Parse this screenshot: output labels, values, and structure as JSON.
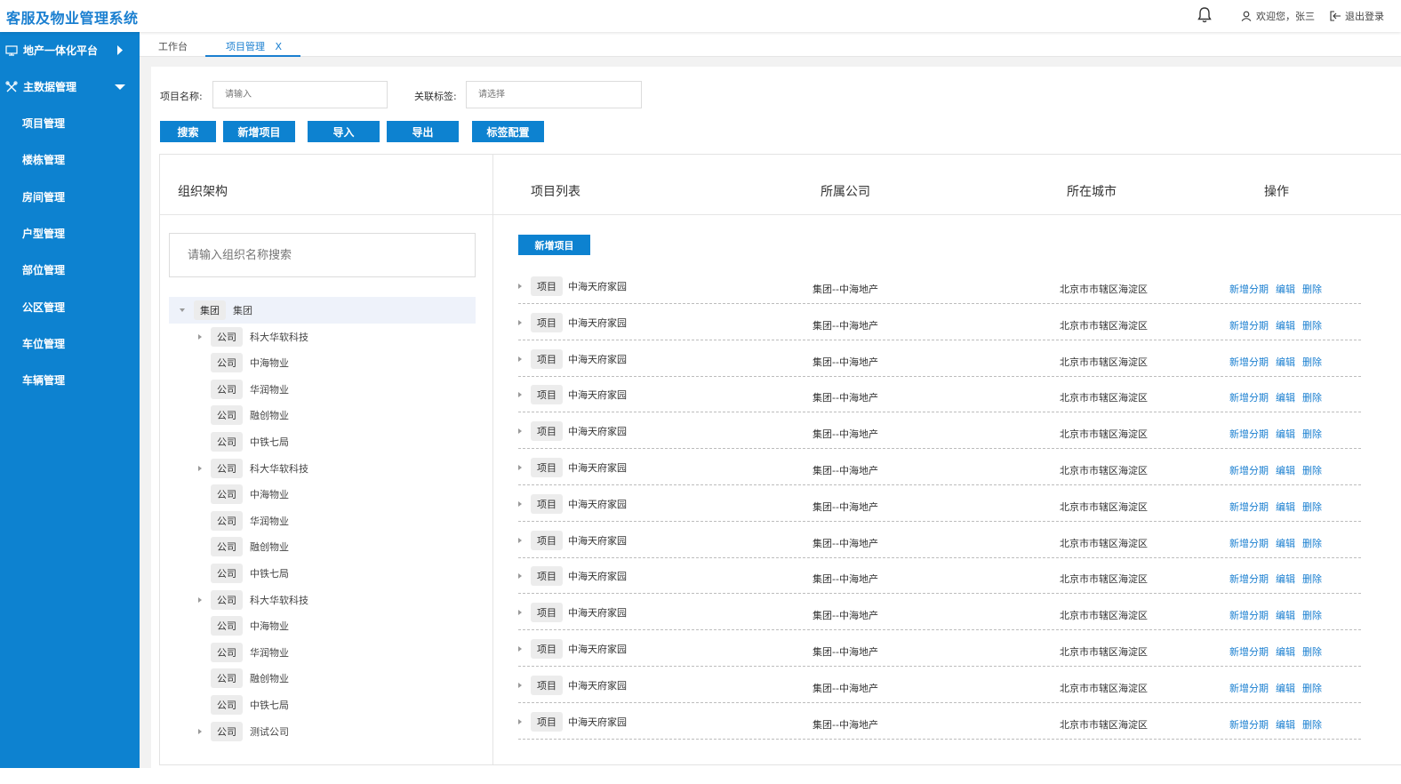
{
  "app_title": "客服及物业管理系统",
  "header": {
    "welcome": "欢迎您，张三",
    "logout": "退出登录"
  },
  "sidebar": {
    "groups": [
      {
        "label": "地产一体化平台"
      },
      {
        "label": "主数据管理"
      }
    ],
    "items": [
      "项目管理",
      "楼栋管理",
      "房间管理",
      "户型管理",
      "部位管理",
      "公区管理",
      "车位管理",
      "车辆管理"
    ]
  },
  "tabs": [
    {
      "label": "工作台"
    },
    {
      "label": "项目管理",
      "close": "X"
    }
  ],
  "filters": {
    "name_label": "项目名称:",
    "name_placeholder": "请输入",
    "tag_label": "关联标签:",
    "tag_placeholder": "请选择"
  },
  "toolbar": {
    "search": "搜索",
    "add": "新增项目",
    "import": "导入",
    "export": "导出",
    "tag_config": "标签配置"
  },
  "org": {
    "title": "组织架构",
    "search_placeholder": "请输入组织名称搜索",
    "nodes": [
      {
        "tag": "集团",
        "name": "集团",
        "level": 0,
        "caret": "down",
        "selected": true
      },
      {
        "tag": "公司",
        "name": "科大华软科技",
        "level": 1,
        "caret": "right"
      },
      {
        "tag": "公司",
        "name": "中海物业",
        "level": 1,
        "caret": "none"
      },
      {
        "tag": "公司",
        "name": "华润物业",
        "level": 1,
        "caret": "none"
      },
      {
        "tag": "公司",
        "name": "融创物业",
        "level": 1,
        "caret": "none"
      },
      {
        "tag": "公司",
        "name": "中铁七局",
        "level": 1,
        "caret": "none"
      },
      {
        "tag": "公司",
        "name": "科大华软科技",
        "level": 1,
        "caret": "right"
      },
      {
        "tag": "公司",
        "name": "中海物业",
        "level": 1,
        "caret": "none"
      },
      {
        "tag": "公司",
        "name": "华润物业",
        "level": 1,
        "caret": "none"
      },
      {
        "tag": "公司",
        "name": "融创物业",
        "level": 1,
        "caret": "none"
      },
      {
        "tag": "公司",
        "name": "中铁七局",
        "level": 1,
        "caret": "none"
      },
      {
        "tag": "公司",
        "name": "科大华软科技",
        "level": 1,
        "caret": "right"
      },
      {
        "tag": "公司",
        "name": "中海物业",
        "level": 1,
        "caret": "none"
      },
      {
        "tag": "公司",
        "name": "华润物业",
        "level": 1,
        "caret": "none"
      },
      {
        "tag": "公司",
        "name": "融创物业",
        "level": 1,
        "caret": "none"
      },
      {
        "tag": "公司",
        "name": "中铁七局",
        "level": 1,
        "caret": "none"
      },
      {
        "tag": "公司",
        "name": "测试公司",
        "level": 1,
        "caret": "right"
      }
    ]
  },
  "list": {
    "columns": [
      "项目列表",
      "所属公司",
      "所在城市",
      "操作"
    ],
    "add_label": "新增项目",
    "ops": [
      "新增分期",
      "编辑",
      "删除"
    ],
    "rows": [
      {
        "tag": "项目",
        "name": "中海天府家园",
        "company": "集团--中海地产",
        "city": "北京市市辖区海淀区"
      },
      {
        "tag": "项目",
        "name": "中海天府家园",
        "company": "集团--中海地产",
        "city": "北京市市辖区海淀区"
      },
      {
        "tag": "项目",
        "name": "中海天府家园",
        "company": "集团--中海地产",
        "city": "北京市市辖区海淀区"
      },
      {
        "tag": "项目",
        "name": "中海天府家园",
        "company": "集团--中海地产",
        "city": "北京市市辖区海淀区"
      },
      {
        "tag": "项目",
        "name": "中海天府家园",
        "company": "集团--中海地产",
        "city": "北京市市辖区海淀区"
      },
      {
        "tag": "项目",
        "name": "中海天府家园",
        "company": "集团--中海地产",
        "city": "北京市市辖区海淀区"
      },
      {
        "tag": "项目",
        "name": "中海天府家园",
        "company": "集团--中海地产",
        "city": "北京市市辖区海淀区"
      },
      {
        "tag": "项目",
        "name": "中海天府家园",
        "company": "集团--中海地产",
        "city": "北京市市辖区海淀区"
      },
      {
        "tag": "项目",
        "name": "中海天府家园",
        "company": "集团--中海地产",
        "city": "北京市市辖区海淀区"
      },
      {
        "tag": "项目",
        "name": "中海天府家园",
        "company": "集团--中海地产",
        "city": "北京市市辖区海淀区"
      },
      {
        "tag": "项目",
        "name": "中海天府家园",
        "company": "集团--中海地产",
        "city": "北京市市辖区海淀区"
      },
      {
        "tag": "项目",
        "name": "中海天府家园",
        "company": "集团--中海地产",
        "city": "北京市市辖区海淀区"
      },
      {
        "tag": "项目",
        "name": "中海天府家园",
        "company": "集团--中海地产",
        "city": "北京市市辖区海淀区"
      }
    ]
  },
  "colors": {
    "primary": "#0d82d0",
    "link": "#1a7fd0",
    "tag_bg": "#ececec"
  }
}
